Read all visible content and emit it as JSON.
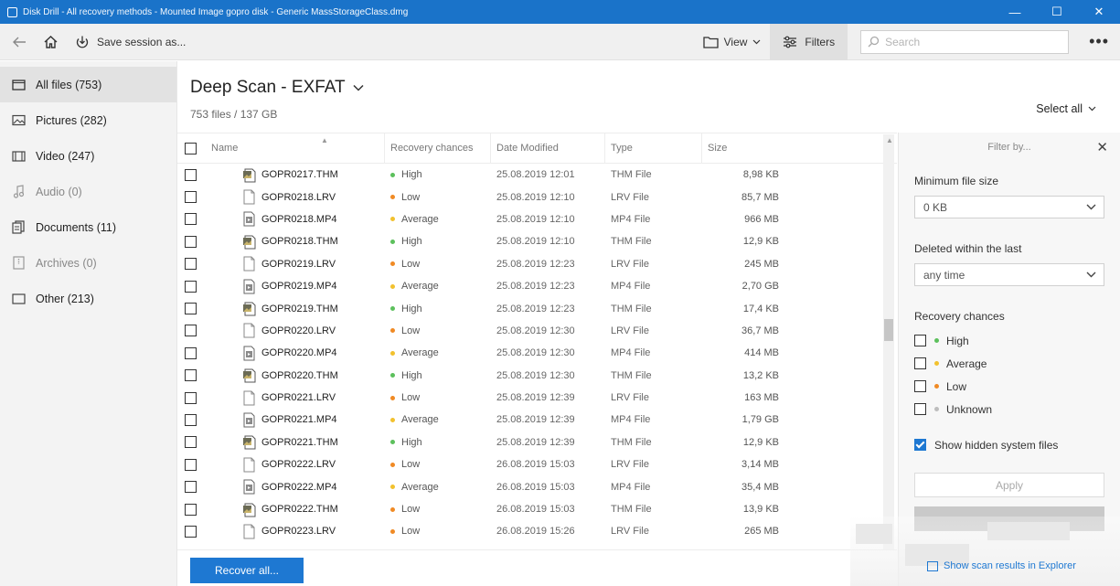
{
  "window": {
    "title": "Disk Drill - All recovery methods - Mounted Image gopro disk - Generic MassStorageClass.dmg",
    "minimize": "—",
    "maximize": "☐",
    "close": "✕"
  },
  "toolbar": {
    "save_session": "Save session as...",
    "view": "View",
    "filters": "Filters",
    "search_placeholder": "Search",
    "more": "•••"
  },
  "sidebar": {
    "items": [
      {
        "label": "All files (753)",
        "icon": "folder-icon",
        "active": true,
        "dim": false
      },
      {
        "label": "Pictures (282)",
        "icon": "picture-icon",
        "active": false,
        "dim": false
      },
      {
        "label": "Video (247)",
        "icon": "video-icon",
        "active": false,
        "dim": false
      },
      {
        "label": "Audio (0)",
        "icon": "music-note-icon",
        "active": false,
        "dim": true
      },
      {
        "label": "Documents (11)",
        "icon": "document-icon",
        "active": false,
        "dim": false
      },
      {
        "label": "Archives (0)",
        "icon": "archive-icon",
        "active": false,
        "dim": true
      },
      {
        "label": "Other (213)",
        "icon": "other-folder-icon",
        "active": false,
        "dim": false
      }
    ]
  },
  "main": {
    "title": "Deep Scan - EXFAT",
    "subtitle": "753 files / 137 GB",
    "select_all": "Select all",
    "columns": {
      "name": "Name",
      "recovery": "Recovery chances",
      "date": "Date Modified",
      "type": "Type",
      "size": "Size"
    },
    "rows": [
      {
        "name": "GOPR0217.THM",
        "kind": "thm",
        "recovery": "High",
        "date": "25.08.2019 12:01",
        "type": "THM File",
        "size": "8,98 KB"
      },
      {
        "name": "GOPR0218.LRV",
        "kind": "lrv",
        "recovery": "Low",
        "date": "25.08.2019 12:10",
        "type": "LRV File",
        "size": "85,7 MB"
      },
      {
        "name": "GOPR0218.MP4",
        "kind": "mp4",
        "recovery": "Average",
        "date": "25.08.2019 12:10",
        "type": "MP4 File",
        "size": "966 MB"
      },
      {
        "name": "GOPR0218.THM",
        "kind": "thm",
        "recovery": "High",
        "date": "25.08.2019 12:10",
        "type": "THM File",
        "size": "12,9 KB"
      },
      {
        "name": "GOPR0219.LRV",
        "kind": "lrv",
        "recovery": "Low",
        "date": "25.08.2019 12:23",
        "type": "LRV File",
        "size": "245 MB"
      },
      {
        "name": "GOPR0219.MP4",
        "kind": "mp4",
        "recovery": "Average",
        "date": "25.08.2019 12:23",
        "type": "MP4 File",
        "size": "2,70 GB"
      },
      {
        "name": "GOPR0219.THM",
        "kind": "thm",
        "recovery": "High",
        "date": "25.08.2019 12:23",
        "type": "THM File",
        "size": "17,4 KB"
      },
      {
        "name": "GOPR0220.LRV",
        "kind": "lrv",
        "recovery": "Low",
        "date": "25.08.2019 12:30",
        "type": "LRV File",
        "size": "36,7 MB"
      },
      {
        "name": "GOPR0220.MP4",
        "kind": "mp4",
        "recovery": "Average",
        "date": "25.08.2019 12:30",
        "type": "MP4 File",
        "size": "414 MB"
      },
      {
        "name": "GOPR0220.THM",
        "kind": "thm",
        "recovery": "High",
        "date": "25.08.2019 12:30",
        "type": "THM File",
        "size": "13,2 KB"
      },
      {
        "name": "GOPR0221.LRV",
        "kind": "lrv",
        "recovery": "Low",
        "date": "25.08.2019 12:39",
        "type": "LRV File",
        "size": "163 MB"
      },
      {
        "name": "GOPR0221.MP4",
        "kind": "mp4",
        "recovery": "Average",
        "date": "25.08.2019 12:39",
        "type": "MP4 File",
        "size": "1,79 GB"
      },
      {
        "name": "GOPR0221.THM",
        "kind": "thm",
        "recovery": "High",
        "date": "25.08.2019 12:39",
        "type": "THM File",
        "size": "12,9 KB"
      },
      {
        "name": "GOPR0222.LRV",
        "kind": "lrv",
        "recovery": "Low",
        "date": "26.08.2019 15:03",
        "type": "LRV File",
        "size": "3,14 MB"
      },
      {
        "name": "GOPR0222.MP4",
        "kind": "mp4",
        "recovery": "Average",
        "date": "26.08.2019 15:03",
        "type": "MP4 File",
        "size": "35,4 MB"
      },
      {
        "name": "GOPR0222.THM",
        "kind": "thm",
        "recovery": "Low",
        "date": "26.08.2019 15:03",
        "type": "THM File",
        "size": "13,9 KB"
      },
      {
        "name": "GOPR0223.LRV",
        "kind": "lrv",
        "recovery": "Low",
        "date": "26.08.2019 15:26",
        "type": "LRV File",
        "size": "265 MB"
      }
    ],
    "recover_all": "Recover all..."
  },
  "filter_panel": {
    "header": "Filter by...",
    "min_size_label": "Minimum file size",
    "min_size_value": "0 KB",
    "deleted_label": "Deleted within the last",
    "deleted_value": "any time",
    "recovery_label": "Recovery chances",
    "recovery_options": [
      {
        "label": "High",
        "level": "high"
      },
      {
        "label": "Average",
        "level": "average"
      },
      {
        "label": "Low",
        "level": "low"
      },
      {
        "label": "Unknown",
        "level": "unknown"
      }
    ],
    "show_hidden": "Show hidden system files",
    "show_hidden_checked": true,
    "apply": "Apply",
    "explorer_link": "Show scan results in Explorer"
  },
  "colors": {
    "accent": "#1e78d2",
    "titlebar": "#1a73c9",
    "high": "#5cc05c",
    "average": "#f2c12e",
    "low": "#f08a24",
    "unknown": "#bdbdbd"
  }
}
